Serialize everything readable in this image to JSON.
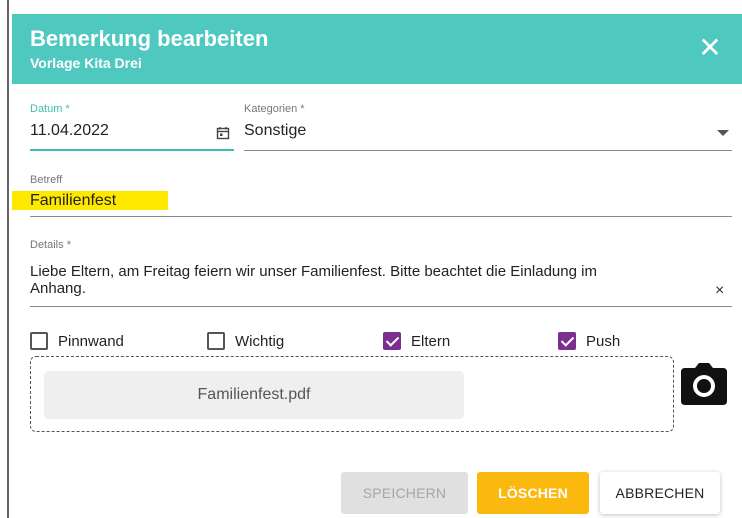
{
  "dialog": {
    "title": "Bemerkung bearbeiten",
    "subtitle": "Vorlage Kita Drei",
    "close_glyph": "✕",
    "header_color": "#4fc9c0"
  },
  "form": {
    "date": {
      "label": "Datum",
      "required_mark": "*",
      "value": "11.04.2022",
      "icon": "calendar-icon"
    },
    "category": {
      "label": "Kategorien",
      "required_mark": "*",
      "value": "Sonstige",
      "icon": "chevron-down-icon"
    },
    "subject": {
      "label": "Betreff",
      "value": "Familienfest",
      "highlight_color": "#ffe800"
    },
    "details": {
      "label": "Details",
      "required_mark": "*",
      "line1": "Liebe Eltern, am Freitag feiern wir unser Familienfest. Bitte beachtet die Einladung im",
      "line2": "Anhang.",
      "clear_glyph": "×"
    }
  },
  "checkboxes": [
    {
      "label": "Pinnwand",
      "checked": false
    },
    {
      "label": "Wichtig",
      "checked": false
    },
    {
      "label": "Eltern",
      "checked": true
    },
    {
      "label": "Push",
      "checked": true
    }
  ],
  "attachment": {
    "file_name": "Familienfest.pdf",
    "camera_icon": "camera-icon"
  },
  "buttons": {
    "save": "SPEICHERN",
    "delete": "LÖSCHEN",
    "cancel": "ABBRECHEN"
  },
  "colors": {
    "accent": "#3fbdb4",
    "checkbox_checked": "#7b2f8e",
    "delete_button": "#fbb80f"
  }
}
